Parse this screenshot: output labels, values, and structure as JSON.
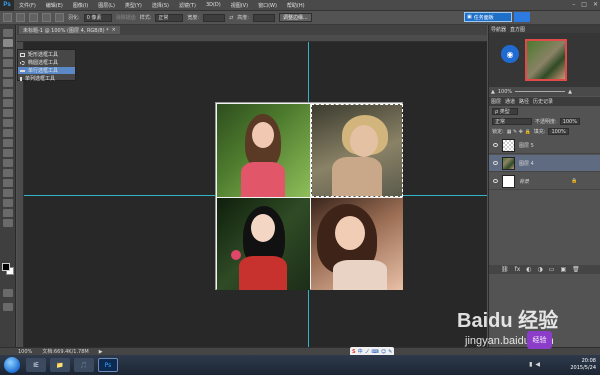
{
  "app": {
    "logo": "Ps"
  },
  "menu": [
    "文件(F)",
    "编辑(E)",
    "图像(I)",
    "图层(L)",
    "类型(Y)",
    "选择(S)",
    "滤镜(T)",
    "3D(D)",
    "视图(V)",
    "窗口(W)",
    "帮助(H)"
  ],
  "window_controls": {
    "minimize": "–",
    "restore": "□",
    "close": "✕"
  },
  "options": {
    "feather_label": "羽化:",
    "feather_value": "0 像素",
    "antialias_label": "消除锯齿",
    "style_label": "样式:",
    "style_value": "正常",
    "width_label": "宽度:",
    "height_label": "高度:",
    "refine_button": "调整边缘...",
    "workspace_badge": "任务面板"
  },
  "document": {
    "tab_title": "未标题-1 @ 100% (图层 4, RGB/8) *",
    "close_glyph": "×"
  },
  "flyout": {
    "items": [
      {
        "label": "矩形选框工具",
        "selected": false
      },
      {
        "label": "椭圆选框工具",
        "selected": false
      },
      {
        "label": "单行选框工具",
        "selected": true
      },
      {
        "label": "单列选框工具",
        "selected": false
      }
    ],
    "shortcut": "M"
  },
  "navigator": {
    "tabs": [
      "导航器",
      "直方图"
    ],
    "zoom": "100%"
  },
  "layers": {
    "tabs": [
      "图层",
      "通道",
      "路径",
      "历史记录"
    ],
    "kind_label": "ρ 类型",
    "blend_mode": "正常",
    "opacity_label": "不透明度:",
    "opacity_value": "100%",
    "lock_label": "锁定:",
    "fill_label": "填充:",
    "fill_value": "100%",
    "items": [
      {
        "name": "图层 5",
        "active": false
      },
      {
        "name": "图层 4",
        "active": true
      },
      {
        "name": "背景",
        "active": false
      }
    ],
    "tool_icons": [
      "⛓",
      "fx",
      "◐",
      "◑",
      "▭",
      "▣",
      "🗑"
    ]
  },
  "status": {
    "zoom": "100%",
    "doc_size": "文档:669.4K/1.78M"
  },
  "taskbar": {
    "time": "20:08",
    "date": "2015/5/24",
    "apps": [
      "IE",
      "📁",
      "🎵",
      "Ps"
    ]
  },
  "ime": [
    "S",
    "中",
    "ノ",
    "⌨",
    "☺",
    "✎"
  ],
  "watermark": {
    "text": "Baidu 经验",
    "url": "jingyan.baidu.com",
    "badge": "经验"
  },
  "accent_colors": {
    "guide": "#32b5c8",
    "selection": "#5b89c7",
    "badge": "#1d6fc7"
  }
}
